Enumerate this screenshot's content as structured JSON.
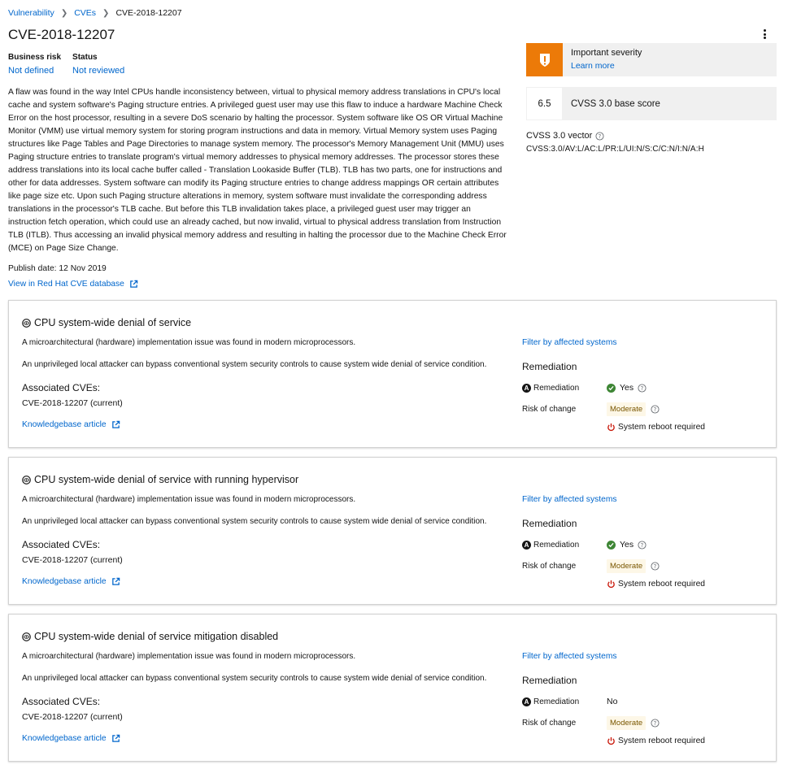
{
  "breadcrumb": {
    "items": [
      "Vulnerability",
      "CVEs"
    ],
    "current": "CVE-2018-12207"
  },
  "title": "CVE-2018-12207",
  "meta": {
    "business_risk_label": "Business risk",
    "business_risk_value": "Not defined",
    "status_label": "Status",
    "status_value": "Not reviewed"
  },
  "description_lines": [
    "A flaw was found in the way Intel CPUs handle inconsistency between, virtual to physical memory address translations in CPU's local",
    "cache and system software's Paging structure entries. A privileged guest user may use this flaw to induce a hardware Machine Check",
    "Error on the host processor, resulting in a severe DoS scenario by halting the processor. System software like OS OR Virtual Machine",
    "Monitor (VMM) use virtual memory system for storing program instructions and data in memory. Virtual Memory system uses Paging",
    "structures like Page Tables and Page Directories to manage system memory. The processor's Memory Management Unit (MMU) uses",
    "Paging structure entries to translate program's virtual memory addresses to physical memory addresses. The processor stores these",
    "address translations into its local cache buffer called - Translation Lookaside Buffer (TLB). TLB has two parts, one for instructions and",
    "other for data addresses. System software can modify its Paging structure entries to change address mappings OR certain attributes",
    "like page size etc. Upon such Paging structure alterations in memory, system software must invalidate the corresponding address",
    "translations in the processor's TLB cache. But before this TLB invalidation takes place, a privileged guest user may trigger an",
    "instruction fetch operation, which could use an already cached, but now invalid, virtual to physical address translation from Instruction",
    "TLB (ITLB). Thus accessing an invalid physical memory address and resulting in halting the processor due to the Machine Check Error",
    "(MCE) on Page Size Change."
  ],
  "publish_date": "Publish date: 12 Nov 2019",
  "redhat_link": "View in Red Hat CVE database",
  "severity": {
    "title": "Important severity",
    "link": "Learn more",
    "color": "#ec7a08"
  },
  "score": {
    "value": "6.5",
    "label": "CVSS 3.0 base score"
  },
  "vector": {
    "label": "CVSS 3.0 vector",
    "value": "CVSS:3.0/AV:L/AC:L/PR:L/UI:N/S:C/C:N/I:N/A:H"
  },
  "rules": [
    {
      "title": "CPU system-wide denial of service",
      "p1": "A microarchitectural (hardware) implementation issue was found in modern microprocessors.",
      "p2": "An unprivileged local attacker can bypass conventional system security controls to cause system wide denial of service condition.",
      "assoc_label": "Associated CVEs:",
      "assoc_value": "CVE-2018-12207 (current)",
      "kb": "Knowledgebase article",
      "filter": "Filter by affected systems",
      "rem_heading": "Remediation",
      "rem_label": "Remediation",
      "rem_value": "Yes",
      "risk_label": "Risk of change",
      "risk_value": "Moderate",
      "reboot": "System reboot required"
    },
    {
      "title": "CPU system-wide denial of service with running hypervisor",
      "p1": "A microarchitectural (hardware) implementation issue was found in modern microprocessors.",
      "p2": "An unprivileged local attacker can bypass conventional system security controls to cause system wide denial of service condition.",
      "assoc_label": "Associated CVEs:",
      "assoc_value": "CVE-2018-12207 (current)",
      "kb": "Knowledgebase article",
      "filter": "Filter by affected systems",
      "rem_heading": "Remediation",
      "rem_label": "Remediation",
      "rem_value": "Yes",
      "risk_label": "Risk of change",
      "risk_value": "Moderate",
      "reboot": "System reboot required"
    },
    {
      "title": "CPU system-wide denial of service mitigation disabled",
      "p1": "A microarchitectural (hardware) implementation issue was found in modern microprocessors.",
      "p2": "An unprivileged local attacker can bypass conventional system security controls to cause system wide denial of service condition.",
      "assoc_label": "Associated CVEs:",
      "assoc_value": "CVE-2018-12207 (current)",
      "kb": "Knowledgebase article",
      "filter": "Filter by affected systems",
      "rem_heading": "Remediation",
      "rem_label": "Remediation",
      "rem_value": "No",
      "risk_label": "Risk of change",
      "risk_value": "Moderate",
      "reboot": "System reboot required"
    }
  ]
}
